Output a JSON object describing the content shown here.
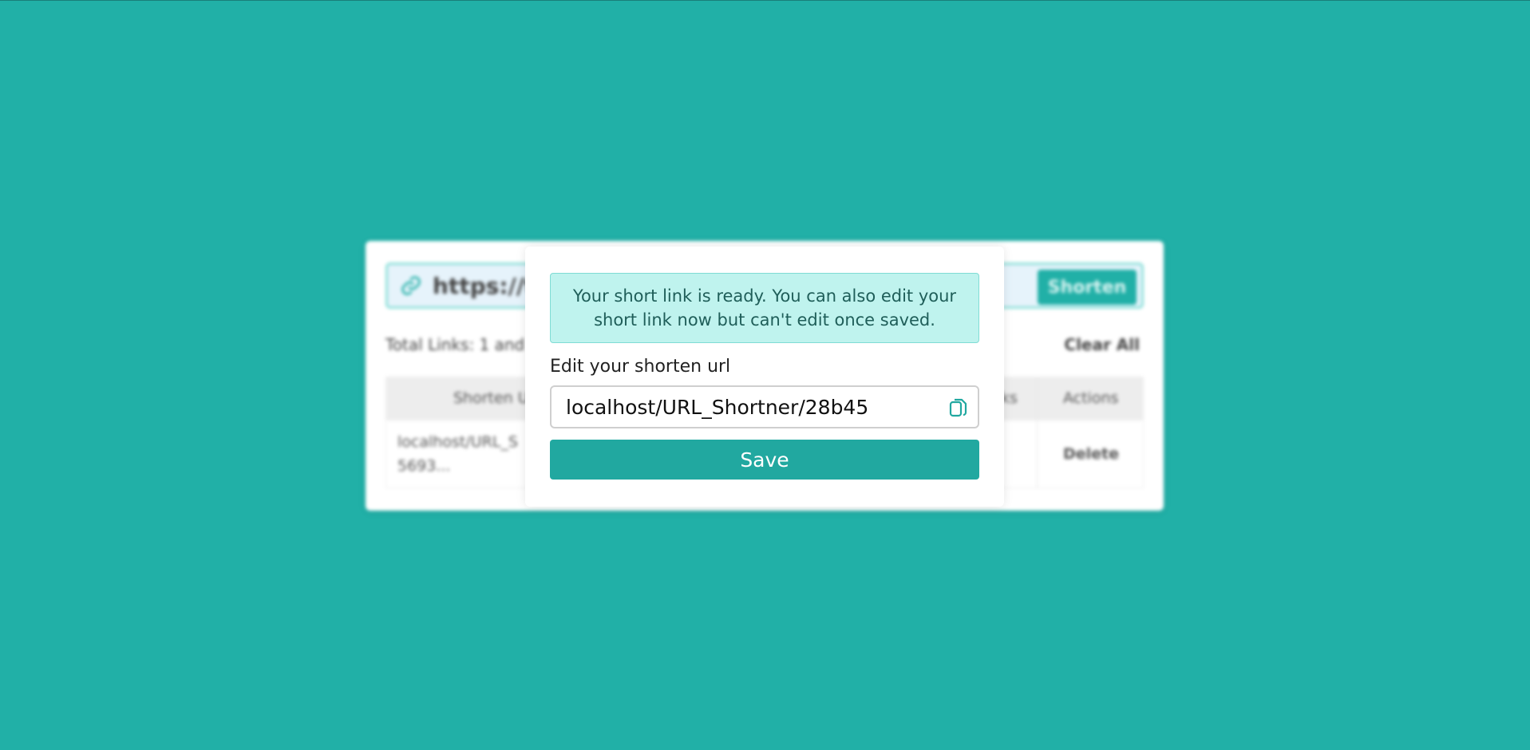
{
  "background_card": {
    "url_input_value": "https://to",
    "shorten_label": "Shorten",
    "total_links_text": "Total Links: 1 and",
    "clear_all_label": "Clear All",
    "table": {
      "headers": [
        "Shorten U",
        "ks",
        "Actions"
      ],
      "row": {
        "short_url_line1": "localhost/URL_S",
        "short_url_line2": "5693...",
        "action": "Delete"
      }
    }
  },
  "modal": {
    "alert_text": "Your short link is ready. You can also edit your short link now but can't edit once saved.",
    "edit_label": "Edit your shorten url",
    "url_value": "localhost/URL_Shortner/28b45",
    "save_label": "Save"
  },
  "colors": {
    "page_bg": "#21b0a7",
    "accent": "#21a8a0",
    "alert_bg": "#bff3ee",
    "alert_border": "#7fdcd4"
  },
  "icons": {
    "link": "link-icon",
    "copy": "copy-icon"
  }
}
